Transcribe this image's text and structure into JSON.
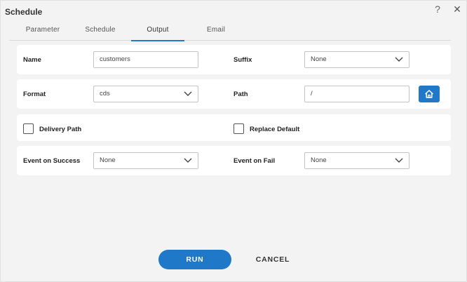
{
  "dialog": {
    "title": "Schedule",
    "help_glyph": "?",
    "close_glyph": "✕"
  },
  "tabs": [
    {
      "label": "Parameter"
    },
    {
      "label": "Schedule"
    },
    {
      "label": "Output",
      "active": true
    },
    {
      "label": "Email"
    }
  ],
  "form": {
    "name": {
      "label": "Name",
      "value": "customers"
    },
    "suffix": {
      "label": "Suffix",
      "value": "None"
    },
    "format": {
      "label": "Format",
      "value": "cds"
    },
    "path": {
      "label": "Path",
      "value": "/"
    },
    "delivery_path": {
      "label": "Delivery Path",
      "checked": false
    },
    "replace_default": {
      "label": "Replace Default",
      "checked": false
    },
    "event_success": {
      "label": "Event on Success",
      "value": "None"
    },
    "event_fail": {
      "label": "Event on Fail",
      "value": "None"
    }
  },
  "icons": {
    "path_browse": "home-icon",
    "select_arrow": "chevron-down-icon"
  },
  "actions": {
    "run": "RUN",
    "cancel": "CANCEL"
  },
  "colors": {
    "accent": "#1f78c8",
    "background": "#f3f3f3",
    "panel": "#ffffff"
  }
}
